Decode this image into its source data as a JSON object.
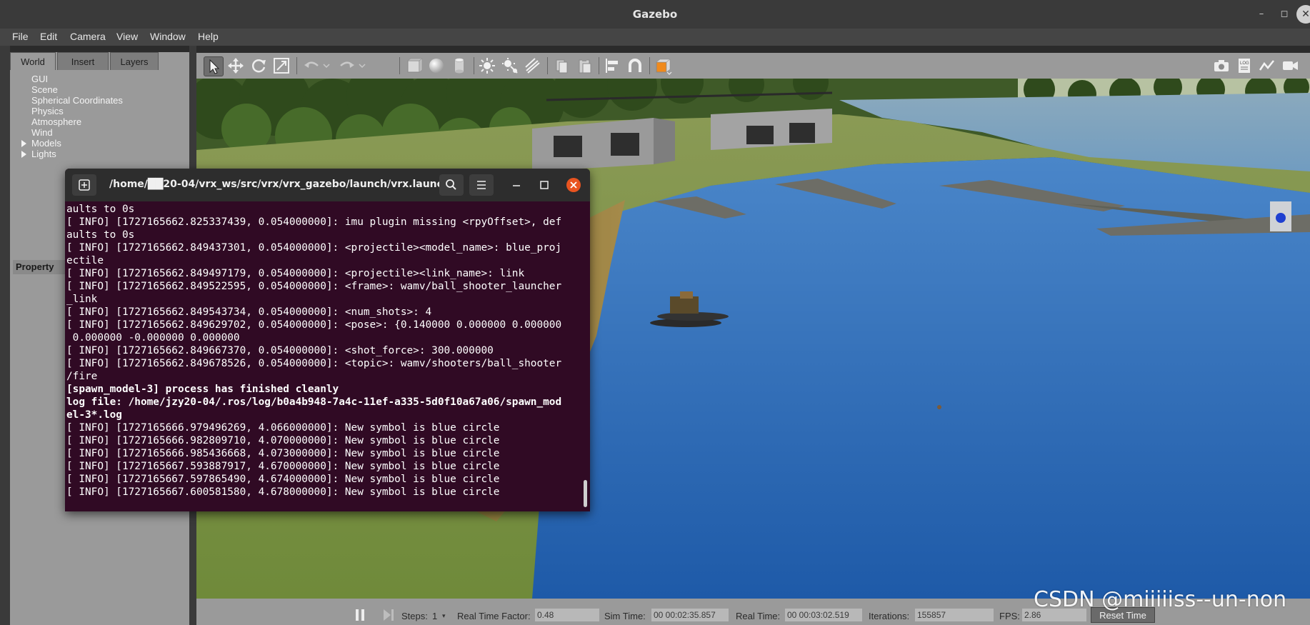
{
  "window": {
    "title": "Gazebo",
    "controls": {
      "minimize": "–",
      "maximize": "◻",
      "close": "✕"
    }
  },
  "menubar": [
    "File",
    "Edit",
    "Camera",
    "View",
    "Window",
    "Help"
  ],
  "left_panel": {
    "tabs": [
      "World",
      "Insert",
      "Layers"
    ],
    "tree": [
      "GUI",
      "Scene",
      "Spherical Coordinates",
      "Physics",
      "Atmosphere",
      "Wind",
      "Models",
      "Lights"
    ],
    "property_header": "Property"
  },
  "toolbar": {
    "icons": [
      "select-arrow-icon",
      "translate-icon",
      "rotate-icon",
      "scale-icon",
      "undo-icon",
      "redo-icon",
      "box-icon",
      "sphere-icon",
      "cylinder-icon",
      "point-light-icon",
      "spot-light-icon",
      "directional-light-icon",
      "copy-icon",
      "paste-icon",
      "align-icon",
      "snap-icon",
      "view-angle-icon",
      "screenshot-icon",
      "log-icon",
      "plot-icon",
      "video-icon"
    ]
  },
  "terminal": {
    "title": "/home/██20-04/vrx_ws/src/vrx/vrx_gazebo/launch/vrx.launc...",
    "lines": [
      {
        "text": "aults to 0s",
        "bold": false
      },
      {
        "text": "[ INFO] [1727165662.825337439, 0.054000000]: imu plugin missing <rpyOffset>, def",
        "bold": false
      },
      {
        "text": "aults to 0s",
        "bold": false
      },
      {
        "text": "[ INFO] [1727165662.849437301, 0.054000000]: <projectile><model_name>: blue_proj",
        "bold": false
      },
      {
        "text": "ectile",
        "bold": false
      },
      {
        "text": "[ INFO] [1727165662.849497179, 0.054000000]: <projectile><link_name>: link",
        "bold": false
      },
      {
        "text": "[ INFO] [1727165662.849522595, 0.054000000]: <frame>: wamv/ball_shooter_launcher",
        "bold": false
      },
      {
        "text": "_link",
        "bold": false
      },
      {
        "text": "[ INFO] [1727165662.849543734, 0.054000000]: <num_shots>: 4",
        "bold": false
      },
      {
        "text": "[ INFO] [1727165662.849629702, 0.054000000]: <pose>: {0.140000 0.000000 0.000000",
        "bold": false
      },
      {
        "text": " 0.000000 -0.000000 0.000000",
        "bold": false
      },
      {
        "text": "[ INFO] [1727165662.849667370, 0.054000000]: <shot_force>: 300.000000",
        "bold": false
      },
      {
        "text": "[ INFO] [1727165662.849678526, 0.054000000]: <topic>: wamv/shooters/ball_shooter",
        "bold": false
      },
      {
        "text": "/fire",
        "bold": false
      },
      {
        "text": "[spawn_model-3] process has finished cleanly",
        "bold": true
      },
      {
        "text": "log file: /home/jzy20-04/.ros/log/b0a4b948-7a4c-11ef-a335-5d0f10a67a06/spawn_mod",
        "bold": true
      },
      {
        "text": "el-3*.log",
        "bold": true
      },
      {
        "text": "[ INFO] [1727165666.979496269, 4.066000000]: New symbol is blue circle",
        "bold": false
      },
      {
        "text": "[ INFO] [1727165666.982809710, 4.070000000]: New symbol is blue circle",
        "bold": false
      },
      {
        "text": "[ INFO] [1727165666.985436668, 4.073000000]: New symbol is blue circle",
        "bold": false
      },
      {
        "text": "[ INFO] [1727165667.593887917, 4.670000000]: New symbol is blue circle",
        "bold": false
      },
      {
        "text": "[ INFO] [1727165667.597865490, 4.674000000]: New symbol is blue circle",
        "bold": false
      },
      {
        "text": "[ INFO] [1727165667.600581580, 4.678000000]: New symbol is blue circle",
        "bold": false
      }
    ]
  },
  "bottom_bar": {
    "steps_label": "Steps:",
    "steps_value": "1",
    "rtf_label": "Real Time Factor:",
    "rtf_value": "0.48",
    "sim_time_label": "Sim Time:",
    "sim_time_value": "00 00:02:35.857",
    "real_time_label": "Real Time:",
    "real_time_value": "00 00:03:02.519",
    "iterations_label": "Iterations:",
    "iterations_value": "155857",
    "fps_label": "FPS:",
    "fps_value": "2.86",
    "reset_label": "Reset Time"
  },
  "watermark": "CSDN @miiiiiss--un-non",
  "colors": {
    "terminal_bg": "#300a24",
    "water": "#2f6fb8",
    "grass": "#6b8a3a",
    "terminal_close": "#e95420"
  }
}
